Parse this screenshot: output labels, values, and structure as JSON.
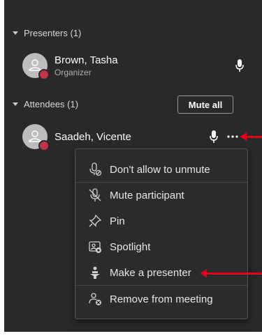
{
  "colors": {
    "panel_bg": "#292929",
    "status_busy": "#c4314b",
    "annotation_arrow": "#e3001b"
  },
  "presenters": {
    "header": "Presenters (1)",
    "people": [
      {
        "name": "Brown, Tasha",
        "role": "Organizer",
        "icon": "mic-icon"
      }
    ]
  },
  "attendees": {
    "header": "Attendees (1)",
    "mute_all_label": "Mute all",
    "people": [
      {
        "name": "Saadeh, Vicente",
        "icons": [
          "mic-icon",
          "more-options-icon"
        ]
      }
    ]
  },
  "context_menu": {
    "items": [
      {
        "label": "Don't allow to unmute",
        "icon": "mic-blocked-icon"
      },
      {
        "label": "Mute participant",
        "icon": "mic-off-icon"
      },
      {
        "label": "Pin",
        "icon": "pin-icon"
      },
      {
        "label": "Spotlight",
        "icon": "spotlight-icon"
      },
      {
        "label": "Make a presenter",
        "icon": "presenter-icon"
      },
      {
        "label": "Remove from meeting",
        "icon": "remove-person-icon"
      }
    ]
  }
}
